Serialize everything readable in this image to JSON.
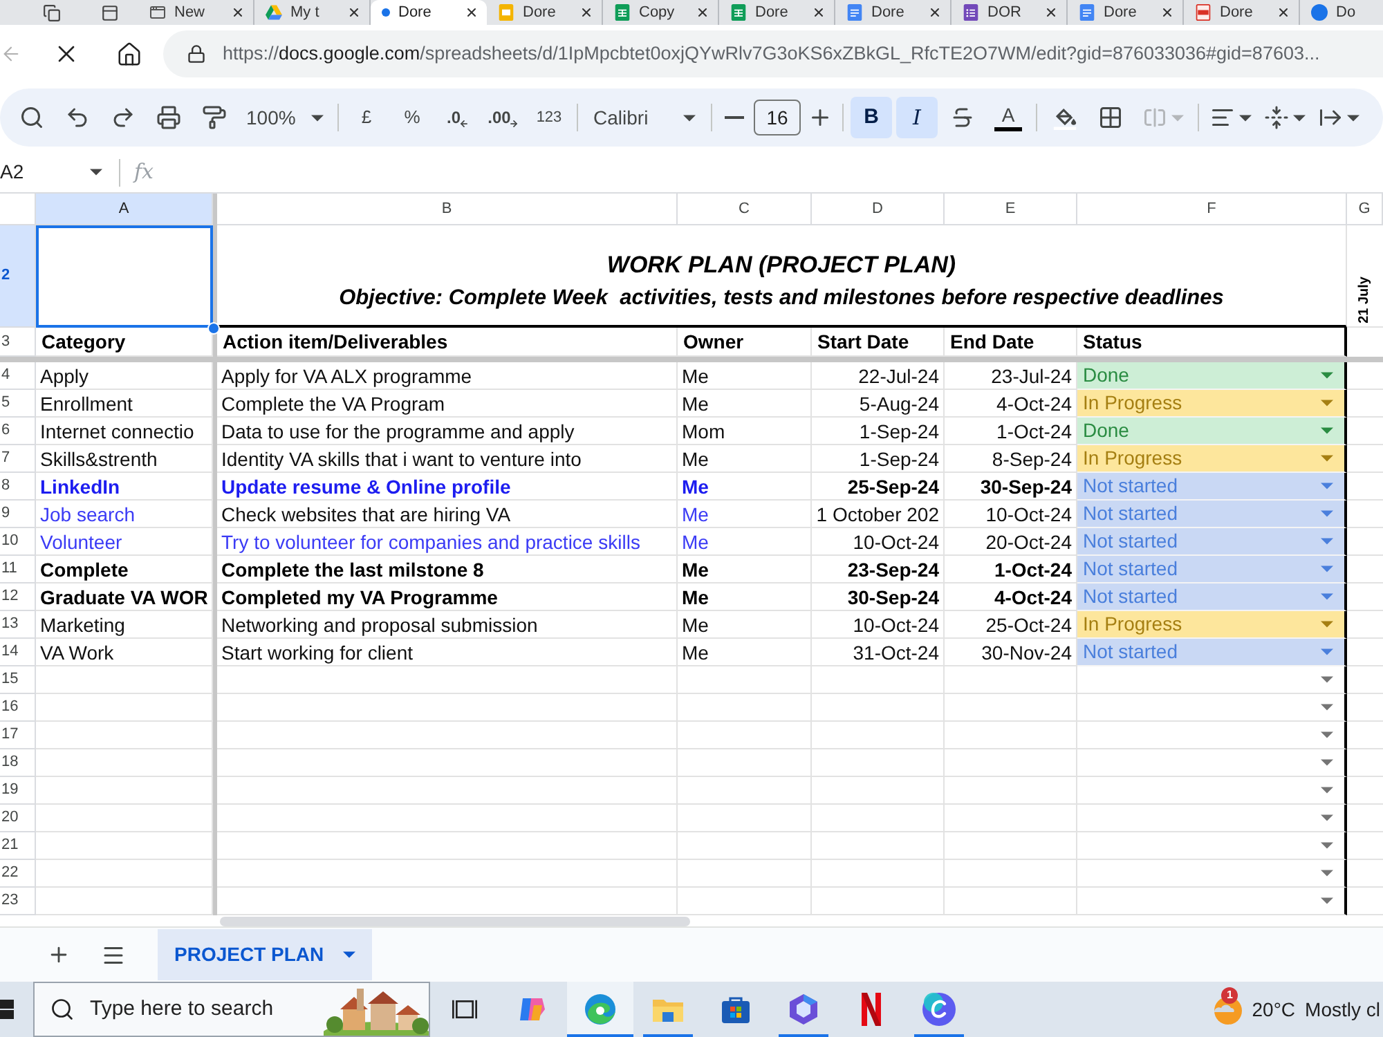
{
  "browser": {
    "tabs": [
      {
        "title": "New",
        "kind": "newtab",
        "selected": false
      },
      {
        "title": "My t",
        "kind": "drive",
        "selected": false
      },
      {
        "title": "Dore",
        "kind": "loading",
        "selected": true
      },
      {
        "title": "Dore",
        "kind": "slides",
        "selected": false
      },
      {
        "title": "Copy",
        "kind": "sheets",
        "selected": false
      },
      {
        "title": "Dore",
        "kind": "sheets",
        "selected": false
      },
      {
        "title": "Dore",
        "kind": "docs",
        "selected": false
      },
      {
        "title": "DOR",
        "kind": "forms",
        "selected": false
      },
      {
        "title": "Dore",
        "kind": "docs",
        "selected": false
      },
      {
        "title": "Dore",
        "kind": "pdf",
        "selected": false
      },
      {
        "title": "Do",
        "kind": "profile",
        "selected": false
      }
    ],
    "address": {
      "scheme": "https://",
      "host": "docs.google.com",
      "path": "/spreadsheets/d/1IpMpcbtet0oxjQYwRlv7G3oKS6xZBkGL_RfcTE2O7WM/edit?gid=876033036#gid=87603..."
    }
  },
  "toolbar": {
    "zoom": "100%",
    "currency": "£",
    "percent": "%",
    "decrease_decimal": ".0",
    "increase_decimal": ".00",
    "number_format": "123",
    "font": "Calibri",
    "font_size": "16",
    "bold": {
      "label": "B",
      "selected": true
    },
    "italic": {
      "label": "I",
      "selected": true
    },
    "text_color": {
      "label": "A"
    },
    "merge": {
      "disabled": true
    }
  },
  "formula_bar": {
    "name_box": "A2",
    "fx": "fx"
  },
  "sheet": {
    "columns": [
      {
        "label": "A",
        "selected": true
      },
      {
        "label": "B",
        "selected": false
      },
      {
        "label": "C",
        "selected": false
      },
      {
        "label": "D",
        "selected": false
      },
      {
        "label": "E",
        "selected": false
      },
      {
        "label": "F",
        "selected": false
      },
      {
        "label": "G",
        "selected": false
      }
    ],
    "title_row": {
      "number": "2",
      "selected": true,
      "title": "WORK PLAN (PROJECT PLAN)",
      "subtitle": "Objective: Complete Week  activities, tests and milestones before respective deadlines",
      "side_note": "21 July"
    },
    "header_row": {
      "number": "3",
      "selected": false,
      "cells": [
        "Category",
        "Action item/Deliverables",
        "Owner",
        "Start Date",
        "End Date",
        "Status"
      ]
    },
    "rows": [
      {
        "number": "4",
        "selected": false,
        "cells": [
          {
            "text": "Apply",
            "kind": "plain"
          },
          {
            "text": "Apply for VA ALX programme",
            "kind": "plain"
          },
          {
            "text": "Me",
            "kind": "plain"
          },
          {
            "text": "22-Jul-24",
            "kind": "plain"
          },
          {
            "text": "23-Jul-24",
            "kind": "plain"
          }
        ],
        "status": {
          "text": "Done",
          "kind": "done"
        }
      },
      {
        "number": "5",
        "selected": false,
        "cells": [
          {
            "text": "Enrollment",
            "kind": "plain"
          },
          {
            "text": "Complete the VA Program",
            "kind": "plain"
          },
          {
            "text": "Me",
            "kind": "plain"
          },
          {
            "text": "5-Aug-24",
            "kind": "plain"
          },
          {
            "text": "4-Oct-24",
            "kind": "plain"
          }
        ],
        "status": {
          "text": "In Progress",
          "kind": "in_progress"
        }
      },
      {
        "number": "6",
        "selected": false,
        "cells": [
          {
            "text": "Internet connectio",
            "kind": "plain"
          },
          {
            "text": "Data to use for the programme and apply",
            "kind": "plain"
          },
          {
            "text": "Mom",
            "kind": "plain"
          },
          {
            "text": "1-Sep-24",
            "kind": "plain"
          },
          {
            "text": "1-Oct-24",
            "kind": "plain"
          }
        ],
        "status": {
          "text": "Done",
          "kind": "done"
        }
      },
      {
        "number": "7",
        "selected": false,
        "cells": [
          {
            "text": "Skills&strenth",
            "kind": "plain"
          },
          {
            "text": "Identity VA skills that i want to venture into",
            "kind": "plain"
          },
          {
            "text": "Me",
            "kind": "plain"
          },
          {
            "text": "1-Sep-24",
            "kind": "plain"
          },
          {
            "text": "8-Sep-24",
            "kind": "plain"
          }
        ],
        "status": {
          "text": "In Progress",
          "kind": "in_progress"
        }
      },
      {
        "number": "8",
        "selected": false,
        "cells": [
          {
            "text": "LinkedIn",
            "kind": "bold_blue"
          },
          {
            "text": "Update resume & Online profile",
            "kind": "bold_blue"
          },
          {
            "text": "Me",
            "kind": "bold_blue"
          },
          {
            "text": "25-Sep-24",
            "kind": "bold"
          },
          {
            "text": "30-Sep-24",
            "kind": "bold"
          }
        ],
        "status": {
          "text": "Not started",
          "kind": "not_started"
        }
      },
      {
        "number": "9",
        "selected": false,
        "cells": [
          {
            "text": "Job search",
            "kind": "blue"
          },
          {
            "text": "Check websites that are hiring VA",
            "kind": "plain"
          },
          {
            "text": "Me",
            "kind": "blue"
          },
          {
            "text": "1 October 202",
            "kind": "plain"
          },
          {
            "text": "10-Oct-24",
            "kind": "plain"
          }
        ],
        "status": {
          "text": "Not started",
          "kind": "not_started"
        }
      },
      {
        "number": "10",
        "selected": false,
        "cells": [
          {
            "text": "Volunteer",
            "kind": "blue"
          },
          {
            "text": "Try to volunteer for companies and practice skills",
            "kind": "blue"
          },
          {
            "text": "Me",
            "kind": "blue"
          },
          {
            "text": "10-Oct-24",
            "kind": "plain"
          },
          {
            "text": "20-Oct-24",
            "kind": "plain"
          }
        ],
        "status": {
          "text": "Not started",
          "kind": "not_started"
        }
      },
      {
        "number": "11",
        "selected": false,
        "cells": [
          {
            "text": "Complete",
            "kind": "bold"
          },
          {
            "text": "Complete the last milstone 8",
            "kind": "bold"
          },
          {
            "text": "Me",
            "kind": "bold"
          },
          {
            "text": "23-Sep-24",
            "kind": "bold"
          },
          {
            "text": "1-Oct-24",
            "kind": "bold"
          }
        ],
        "status": {
          "text": "Not started",
          "kind": "not_started"
        }
      },
      {
        "number": "12",
        "selected": false,
        "cells": [
          {
            "text": "Graduate VA WOR",
            "kind": "bold"
          },
          {
            "text": "Completed my VA Programme",
            "kind": "bold"
          },
          {
            "text": "Me",
            "kind": "bold"
          },
          {
            "text": "30-Sep-24",
            "kind": "bold"
          },
          {
            "text": "4-Oct-24",
            "kind": "bold"
          }
        ],
        "status": {
          "text": "Not started",
          "kind": "not_started"
        }
      },
      {
        "number": "13",
        "selected": false,
        "cells": [
          {
            "text": "Marketing",
            "kind": "plain"
          },
          {
            "text": "Networking and proposal submission",
            "kind": "plain"
          },
          {
            "text": "Me",
            "kind": "plain"
          },
          {
            "text": "10-Oct-24",
            "kind": "plain"
          },
          {
            "text": "25-Oct-24",
            "kind": "plain"
          }
        ],
        "status": {
          "text": "In Progress",
          "kind": "in_progress"
        }
      },
      {
        "number": "14",
        "selected": false,
        "cells": [
          {
            "text": "VA Work",
            "kind": "plain"
          },
          {
            "text": "Start working for client",
            "kind": "plain"
          },
          {
            "text": "Me",
            "kind": "plain"
          },
          {
            "text": "31-Oct-24",
            "kind": "plain"
          },
          {
            "text": "30-Nov-24",
            "kind": "plain"
          }
        ],
        "status": {
          "text": "Not started",
          "kind": "not_started"
        }
      }
    ],
    "empty_rows": [
      {
        "number": "15",
        "selected": false
      },
      {
        "number": "16",
        "selected": false
      },
      {
        "number": "17",
        "selected": false
      },
      {
        "number": "18",
        "selected": false
      },
      {
        "number": "19",
        "selected": false
      },
      {
        "number": "20",
        "selected": false
      },
      {
        "number": "21",
        "selected": false
      },
      {
        "number": "22",
        "selected": false
      },
      {
        "number": "23",
        "selected": false
      }
    ]
  },
  "sheet_tabs": [
    {
      "label": "PROJECT PLAN",
      "selected": true
    }
  ],
  "taskbar": {
    "search_placeholder": "Type here to search",
    "apps": [
      {
        "kind": "task-view",
        "selected": false,
        "running": false
      },
      {
        "kind": "copilot",
        "selected": false,
        "running": false
      },
      {
        "kind": "edge",
        "selected": true,
        "running": true
      },
      {
        "kind": "explorer",
        "selected": false,
        "running": true
      },
      {
        "kind": "store",
        "selected": false,
        "running": false
      },
      {
        "kind": "hexagon",
        "selected": false,
        "running": true
      },
      {
        "kind": "netflix",
        "selected": false,
        "running": false
      },
      {
        "kind": "canva",
        "selected": false,
        "running": true
      }
    ],
    "weather": {
      "badge": "1",
      "temperature": "20°C",
      "condition": "Mostly cl"
    }
  }
}
